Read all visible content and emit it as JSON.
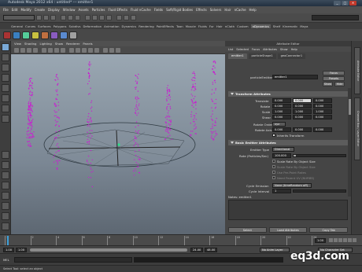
{
  "window": {
    "title": "Autodesk Maya 2012 x64 : untitled*  ---  emitter1",
    "min": "_",
    "max": "□",
    "close": "✕"
  },
  "menubar": [
    "File",
    "Edit",
    "Modify",
    "Create",
    "Display",
    "Window",
    "Assets",
    "Particles",
    "Fluid Effects",
    "Fluid nCache",
    "Fields",
    "Soft/Rigid Bodies",
    "Effects",
    "Solvers",
    "Hair",
    "nCache",
    "Help"
  ],
  "shelf_tabs": [
    "General",
    "Curves",
    "Surfaces",
    "Polygons",
    "Subdivs",
    "Deformation",
    "Animation",
    "Dynamics",
    "Rendering",
    "PaintEffects",
    "Toon",
    "Muscle",
    "Fluids",
    "Fur",
    "Hair",
    "nCloth",
    "Custom",
    "Shelf",
    "Kinematic",
    "Maya"
  ],
  "shelf_selected": "nDynamics",
  "panel_menu": [
    "View",
    "Shading",
    "Lighting",
    "Show",
    "Renderer",
    "Panels"
  ],
  "ae": {
    "title": "Attribute Editor",
    "menu": [
      "List",
      "Selected",
      "Focus",
      "Attributes",
      "Show",
      "Help"
    ],
    "node_tabs": [
      "emitter1",
      "particleShape1",
      "geoConnector1"
    ],
    "selected_node_tab": "emitter1",
    "transform_label": "particleEmitter:",
    "transform_value": "emitter1",
    "focus_btn": "Focus",
    "presets_btn": "Presets",
    "show_btn": "Show",
    "hide_btn": "Hide",
    "transform_section": "Transform Attributes",
    "rows": [
      {
        "label": "Translate",
        "v": [
          "0.000",
          "0.000",
          "0.000"
        ]
      },
      {
        "label": "Rotate",
        "v": [
          "0.000",
          "0.000",
          "0.000"
        ]
      },
      {
        "label": "Scale",
        "v": [
          "1.000",
          "1.000",
          "1.000"
        ]
      },
      {
        "label": "Shear",
        "v": [
          "0.000",
          "0.000",
          "0.000"
        ]
      }
    ],
    "rotate_order_label": "Rotate Order",
    "rotate_order_value": "xyz",
    "rotate_axis_label": "Rotate Axis",
    "rotate_axis_v": [
      "0.000",
      "0.000",
      "0.000"
    ],
    "inherits_label": "Inherits Transform",
    "basic_section": "Basic Emitter Attributes",
    "emitter_type_label": "Emitter Type",
    "emitter_type_value": "Directional",
    "rate_label": "Rate (Particles/Sec)",
    "rate_value": "100.000",
    "checks": [
      "Scale Rate By Object Size",
      "Scale Rate By Object Size",
      "Use Per-Point Rates",
      "Need Parent UV (NURBS)"
    ],
    "cycle_label": "Cycle Emission",
    "cycle_value": "None (timeRandom off)",
    "cycle_interval_label": "Cycle Interval",
    "cycle_interval_value": "1",
    "notes_label": "Notes:  emitter1",
    "btn_select": "Select",
    "btn_load": "Load Attributes",
    "btn_copy": "Copy Tab"
  },
  "side_tabs": [
    "Attribute Editor",
    "Channel Box / Layer Editor"
  ],
  "time": {
    "ticks": [
      "1",
      "2",
      "4",
      "6",
      "8",
      "10",
      "12",
      "14",
      "16",
      "18",
      "20",
      "22",
      "24"
    ],
    "current": "1.00"
  },
  "range": {
    "start": "1.00",
    "start2": "1.00",
    "end": "24.00",
    "end2": "48.00",
    "anim_layer": "No Anim Layer",
    "char_set": "No Character Set"
  },
  "cmd": {
    "lang": "MEL"
  },
  "helpline": "Select Tool: select an object",
  "watermark": "eq3d.com"
}
